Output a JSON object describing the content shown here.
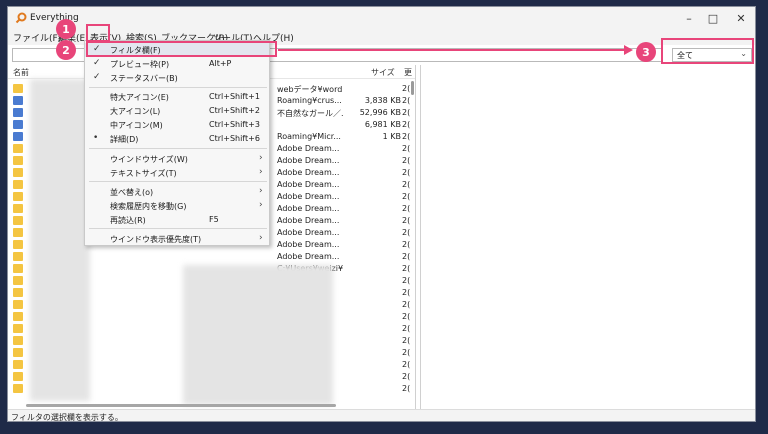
{
  "window": {
    "title": "Everything"
  },
  "menubar": {
    "items": [
      "ファイル(F)",
      "編集(E)",
      "表示(V)",
      "検索(S)",
      "ブックマーク(B)",
      "ツール(T)",
      "ヘルプ(H)"
    ]
  },
  "filter": {
    "selected": "全て"
  },
  "columns": {
    "name": "名前",
    "size": "サイズ",
    "date": "更"
  },
  "rows": [
    {
      "path": "webデータ¥word...",
      "size": "",
      "date": "2("
    },
    {
      "path": "Roaming¥crus...",
      "size": "3,838 KB",
      "date": "2("
    },
    {
      "path": "不自然なガール／...",
      "size": "52,996 KB",
      "date": "2("
    },
    {
      "path": "",
      "size": "6,981 KB",
      "date": "2("
    },
    {
      "path": "Roaming¥Micr...",
      "size": "1 KB",
      "date": "2("
    },
    {
      "path": "Adobe Dream...",
      "size": "",
      "date": "2("
    },
    {
      "path": "Adobe Dream...",
      "size": "",
      "date": "2("
    },
    {
      "path": "Adobe Dream...",
      "size": "",
      "date": "2("
    },
    {
      "path": "Adobe Dream...",
      "size": "",
      "date": "2("
    },
    {
      "path": "Adobe Dream...",
      "size": "",
      "date": "2("
    },
    {
      "path": "Adobe Dream...",
      "size": "",
      "date": "2("
    },
    {
      "path": "Adobe Dream...",
      "size": "",
      "date": "2("
    },
    {
      "path": "Adobe Dream...",
      "size": "",
      "date": "2("
    },
    {
      "path": "Adobe Dream...",
      "size": "",
      "date": "2("
    },
    {
      "path": "Adobe Dream...",
      "size": "",
      "date": "2("
    },
    {
      "path": "C:¥Users¥weizi¥AppData¥Local¥Packag...",
      "size": "",
      "date": "2("
    },
    {
      "path": "...",
      "size": "",
      "date": "2("
    },
    {
      "path": "...",
      "size": "",
      "date": "2("
    },
    {
      "path": "...",
      "size": "",
      "date": "2("
    },
    {
      "path": "...",
      "size": "",
      "date": "2("
    },
    {
      "path": "...",
      "size": "",
      "date": "2("
    },
    {
      "path": "...",
      "size": "",
      "date": "2("
    },
    {
      "path": "...",
      "size": "",
      "date": "2("
    },
    {
      "path": "...",
      "size": "",
      "date": "2("
    },
    {
      "path": "...",
      "size": "",
      "date": "2("
    },
    {
      "path": "...",
      "size": "",
      "date": "2("
    }
  ],
  "menu_view": {
    "items": [
      {
        "label": "フィルタ欄(F)",
        "shortcut": "",
        "check": "✓",
        "arrow": ""
      },
      {
        "label": "プレビュー枠(P)",
        "shortcut": "Alt+P",
        "check": "✓",
        "arrow": ""
      },
      {
        "label": "ステータスバー(B)",
        "shortcut": "",
        "check": "✓",
        "arrow": ""
      },
      {
        "label": "特大アイコン(E)",
        "shortcut": "Ctrl+Shift+1",
        "check": "",
        "arrow": ""
      },
      {
        "label": "大アイコン(L)",
        "shortcut": "Ctrl+Shift+2",
        "check": "",
        "arrow": ""
      },
      {
        "label": "中アイコン(M)",
        "shortcut": "Ctrl+Shift+3",
        "check": "",
        "arrow": ""
      },
      {
        "label": "詳細(D)",
        "shortcut": "Ctrl+Shift+6",
        "check": "•",
        "arrow": ""
      },
      {
        "label": "ウインドウサイズ(W)",
        "shortcut": "",
        "check": "",
        "arrow": "›"
      },
      {
        "label": "テキストサイズ(T)",
        "shortcut": "",
        "check": "",
        "arrow": "›"
      },
      {
        "label": "並べ替え(o)",
        "shortcut": "",
        "check": "",
        "arrow": "›"
      },
      {
        "label": "検索履歴内を移動(G)",
        "shortcut": "",
        "check": "",
        "arrow": "›"
      },
      {
        "label": "再読込(R)",
        "shortcut": "F5",
        "check": "",
        "arrow": ""
      },
      {
        "label": "ウインドウ表示優先度(T)",
        "shortcut": "",
        "check": "",
        "arrow": "›"
      }
    ]
  },
  "status": {
    "text": "フィルタの選択欄を表示する。"
  },
  "annotations": {
    "badges": [
      "1",
      "2",
      "3"
    ],
    "color": "#e8457a"
  }
}
